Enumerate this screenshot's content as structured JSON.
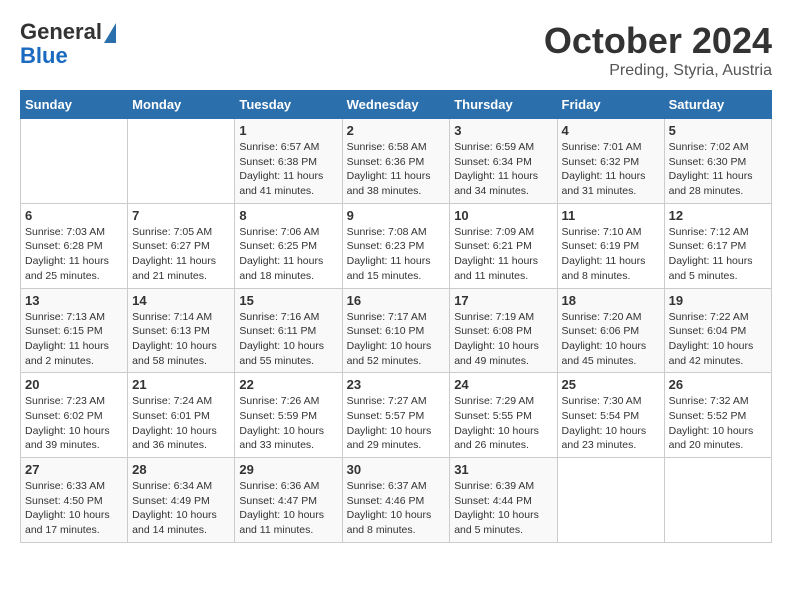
{
  "header": {
    "logo_general": "General",
    "logo_blue": "Blue",
    "month_year": "October 2024",
    "location": "Preding, Styria, Austria"
  },
  "calendar": {
    "days_of_week": [
      "Sunday",
      "Monday",
      "Tuesday",
      "Wednesday",
      "Thursday",
      "Friday",
      "Saturday"
    ],
    "weeks": [
      [
        {
          "day": "",
          "info": ""
        },
        {
          "day": "",
          "info": ""
        },
        {
          "day": "1",
          "info": "Sunrise: 6:57 AM\nSunset: 6:38 PM\nDaylight: 11 hours and 41 minutes."
        },
        {
          "day": "2",
          "info": "Sunrise: 6:58 AM\nSunset: 6:36 PM\nDaylight: 11 hours and 38 minutes."
        },
        {
          "day": "3",
          "info": "Sunrise: 6:59 AM\nSunset: 6:34 PM\nDaylight: 11 hours and 34 minutes."
        },
        {
          "day": "4",
          "info": "Sunrise: 7:01 AM\nSunset: 6:32 PM\nDaylight: 11 hours and 31 minutes."
        },
        {
          "day": "5",
          "info": "Sunrise: 7:02 AM\nSunset: 6:30 PM\nDaylight: 11 hours and 28 minutes."
        }
      ],
      [
        {
          "day": "6",
          "info": "Sunrise: 7:03 AM\nSunset: 6:28 PM\nDaylight: 11 hours and 25 minutes."
        },
        {
          "day": "7",
          "info": "Sunrise: 7:05 AM\nSunset: 6:27 PM\nDaylight: 11 hours and 21 minutes."
        },
        {
          "day": "8",
          "info": "Sunrise: 7:06 AM\nSunset: 6:25 PM\nDaylight: 11 hours and 18 minutes."
        },
        {
          "day": "9",
          "info": "Sunrise: 7:08 AM\nSunset: 6:23 PM\nDaylight: 11 hours and 15 minutes."
        },
        {
          "day": "10",
          "info": "Sunrise: 7:09 AM\nSunset: 6:21 PM\nDaylight: 11 hours and 11 minutes."
        },
        {
          "day": "11",
          "info": "Sunrise: 7:10 AM\nSunset: 6:19 PM\nDaylight: 11 hours and 8 minutes."
        },
        {
          "day": "12",
          "info": "Sunrise: 7:12 AM\nSunset: 6:17 PM\nDaylight: 11 hours and 5 minutes."
        }
      ],
      [
        {
          "day": "13",
          "info": "Sunrise: 7:13 AM\nSunset: 6:15 PM\nDaylight: 11 hours and 2 minutes."
        },
        {
          "day": "14",
          "info": "Sunrise: 7:14 AM\nSunset: 6:13 PM\nDaylight: 10 hours and 58 minutes."
        },
        {
          "day": "15",
          "info": "Sunrise: 7:16 AM\nSunset: 6:11 PM\nDaylight: 10 hours and 55 minutes."
        },
        {
          "day": "16",
          "info": "Sunrise: 7:17 AM\nSunset: 6:10 PM\nDaylight: 10 hours and 52 minutes."
        },
        {
          "day": "17",
          "info": "Sunrise: 7:19 AM\nSunset: 6:08 PM\nDaylight: 10 hours and 49 minutes."
        },
        {
          "day": "18",
          "info": "Sunrise: 7:20 AM\nSunset: 6:06 PM\nDaylight: 10 hours and 45 minutes."
        },
        {
          "day": "19",
          "info": "Sunrise: 7:22 AM\nSunset: 6:04 PM\nDaylight: 10 hours and 42 minutes."
        }
      ],
      [
        {
          "day": "20",
          "info": "Sunrise: 7:23 AM\nSunset: 6:02 PM\nDaylight: 10 hours and 39 minutes."
        },
        {
          "day": "21",
          "info": "Sunrise: 7:24 AM\nSunset: 6:01 PM\nDaylight: 10 hours and 36 minutes."
        },
        {
          "day": "22",
          "info": "Sunrise: 7:26 AM\nSunset: 5:59 PM\nDaylight: 10 hours and 33 minutes."
        },
        {
          "day": "23",
          "info": "Sunrise: 7:27 AM\nSunset: 5:57 PM\nDaylight: 10 hours and 29 minutes."
        },
        {
          "day": "24",
          "info": "Sunrise: 7:29 AM\nSunset: 5:55 PM\nDaylight: 10 hours and 26 minutes."
        },
        {
          "day": "25",
          "info": "Sunrise: 7:30 AM\nSunset: 5:54 PM\nDaylight: 10 hours and 23 minutes."
        },
        {
          "day": "26",
          "info": "Sunrise: 7:32 AM\nSunset: 5:52 PM\nDaylight: 10 hours and 20 minutes."
        }
      ],
      [
        {
          "day": "27",
          "info": "Sunrise: 6:33 AM\nSunset: 4:50 PM\nDaylight: 10 hours and 17 minutes."
        },
        {
          "day": "28",
          "info": "Sunrise: 6:34 AM\nSunset: 4:49 PM\nDaylight: 10 hours and 14 minutes."
        },
        {
          "day": "29",
          "info": "Sunrise: 6:36 AM\nSunset: 4:47 PM\nDaylight: 10 hours and 11 minutes."
        },
        {
          "day": "30",
          "info": "Sunrise: 6:37 AM\nSunset: 4:46 PM\nDaylight: 10 hours and 8 minutes."
        },
        {
          "day": "31",
          "info": "Sunrise: 6:39 AM\nSunset: 4:44 PM\nDaylight: 10 hours and 5 minutes."
        },
        {
          "day": "",
          "info": ""
        },
        {
          "day": "",
          "info": ""
        }
      ]
    ]
  }
}
